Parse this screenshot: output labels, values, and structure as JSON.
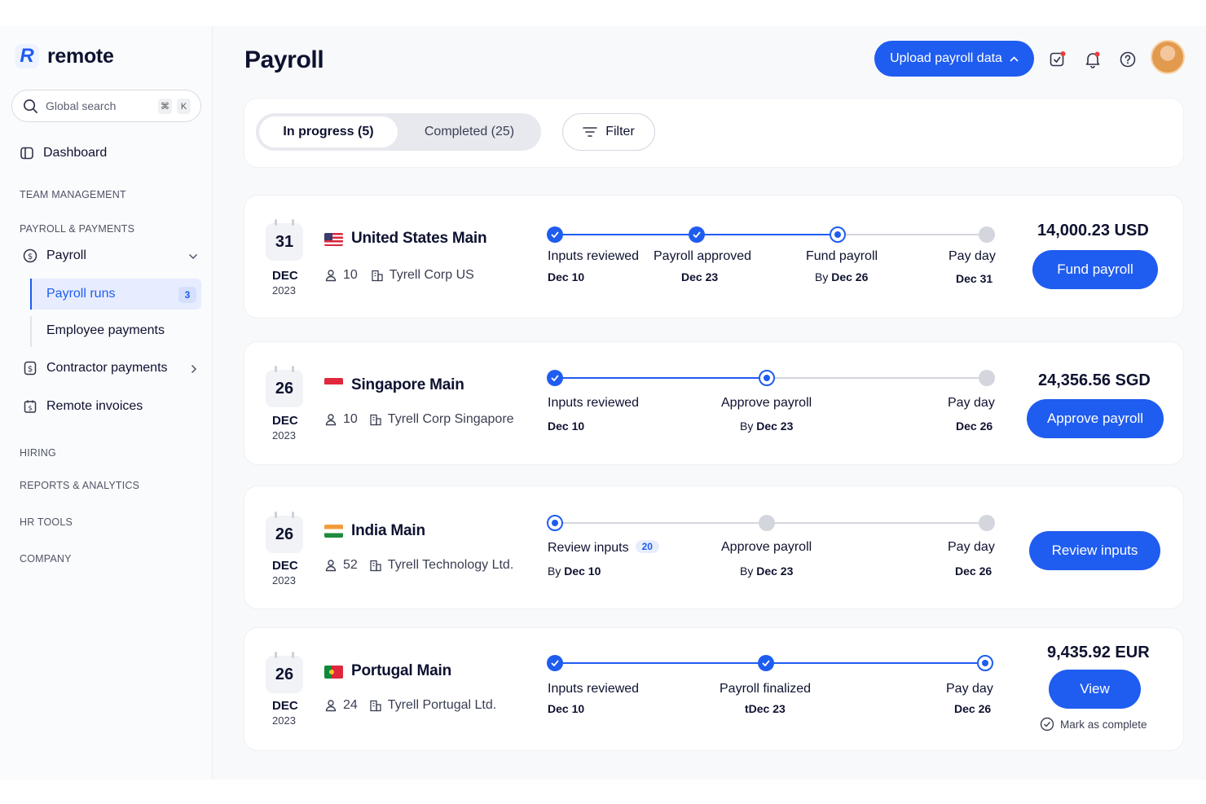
{
  "app": {
    "name": "remote"
  },
  "sidebar": {
    "search": {
      "placeholder": "Global search",
      "shortcut_mod": "⌘",
      "shortcut_key": "K"
    },
    "dashboard": "Dashboard",
    "sections": {
      "team": "TEAM MANAGEMENT",
      "payroll_payments": "PAYROLL & PAYMENTS",
      "hiring": "HIRING",
      "reports": "REPORTS & ANALYTICS",
      "hr_tools": "HR TOOLS",
      "company": "COMPANY"
    },
    "payroll": {
      "label": "Payroll",
      "runs_label": "Payroll runs",
      "runs_count": "3",
      "employee_payments": "Employee payments"
    },
    "contractor_payments": "Contractor payments",
    "remote_invoices": "Remote invoices"
  },
  "header": {
    "title": "Payroll",
    "upload_button": "Upload payroll data"
  },
  "filters": {
    "in_progress": "In progress (5)",
    "completed": "Completed (25)",
    "filter": "Filter"
  },
  "runs": [
    {
      "day": "31",
      "month": "DEC",
      "year": "2023",
      "country": "United States Main",
      "flag": "us",
      "employees": "10",
      "entity": "Tyrell Corp US",
      "amount": "14,000.23 USD",
      "action": "Fund payroll",
      "steps": [
        {
          "label": "Inputs reviewed",
          "prefix": "",
          "date": "Dec 10",
          "state": "done"
        },
        {
          "label": "Payroll approved",
          "prefix": "",
          "date": "Dec 23",
          "state": "done"
        },
        {
          "label": "Fund payroll",
          "prefix": "By ",
          "date": "Dec 26",
          "state": "current"
        },
        {
          "label": "Pay day",
          "prefix": "",
          "date": "Dec 31",
          "state": "todo"
        }
      ]
    },
    {
      "day": "26",
      "month": "DEC",
      "year": "2023",
      "country": "Singapore Main",
      "flag": "sg",
      "employees": "10",
      "entity": "Tyrell Corp Singapore",
      "amount": "24,356.56 SGD",
      "action": "Approve payroll",
      "steps": [
        {
          "label": "Inputs reviewed",
          "prefix": "",
          "date": "Dec 10",
          "state": "done"
        },
        {
          "label": "Approve payroll",
          "prefix": "By ",
          "date": "Dec 23",
          "state": "current"
        },
        {
          "label": "Pay day",
          "prefix": "",
          "date": "Dec 26",
          "state": "todo"
        }
      ]
    },
    {
      "day": "26",
      "month": "DEC",
      "year": "2023",
      "country": "India Main",
      "flag": "in",
      "employees": "52",
      "entity": "Tyrell Technology Ltd.",
      "amount": "",
      "action": "Review inputs",
      "steps": [
        {
          "label": "Review inputs",
          "badge": "20",
          "prefix": "By ",
          "date": "Dec 10",
          "state": "current"
        },
        {
          "label": "Approve payroll",
          "prefix": "By ",
          "date": "Dec 23",
          "state": "todo"
        },
        {
          "label": "Pay day",
          "prefix": "",
          "date": "Dec 26",
          "state": "todo"
        }
      ]
    },
    {
      "day": "26",
      "month": "DEC",
      "year": "2023",
      "country": "Portugal Main",
      "flag": "pt",
      "employees": "24",
      "entity": "Tyrell Portugal Ltd.",
      "amount": "9,435.92 EUR",
      "action": "View",
      "mark_complete": "Mark as complete",
      "steps": [
        {
          "label": "Inputs reviewed",
          "prefix": "",
          "date": "Dec 10",
          "state": "done"
        },
        {
          "label": "Payroll finalized",
          "prefix": "",
          "date": "tDec 23",
          "state": "done"
        },
        {
          "label": "Pay day",
          "prefix": "",
          "date": "Dec 26",
          "state": "current"
        }
      ]
    }
  ],
  "colors": {
    "accent": "#1f5cf0",
    "badge_bg": "#e7edff",
    "step_todo": "#d3d6dd",
    "notification": "#ef3b3b"
  },
  "icons": [
    "search-icon",
    "dashboard-icon",
    "dollar-icon",
    "chevron-down-icon",
    "chevron-right-icon",
    "invoice-icon",
    "tasks-icon",
    "bell-icon",
    "help-icon",
    "filter-icon",
    "user-icon",
    "building-icon",
    "check-icon"
  ]
}
